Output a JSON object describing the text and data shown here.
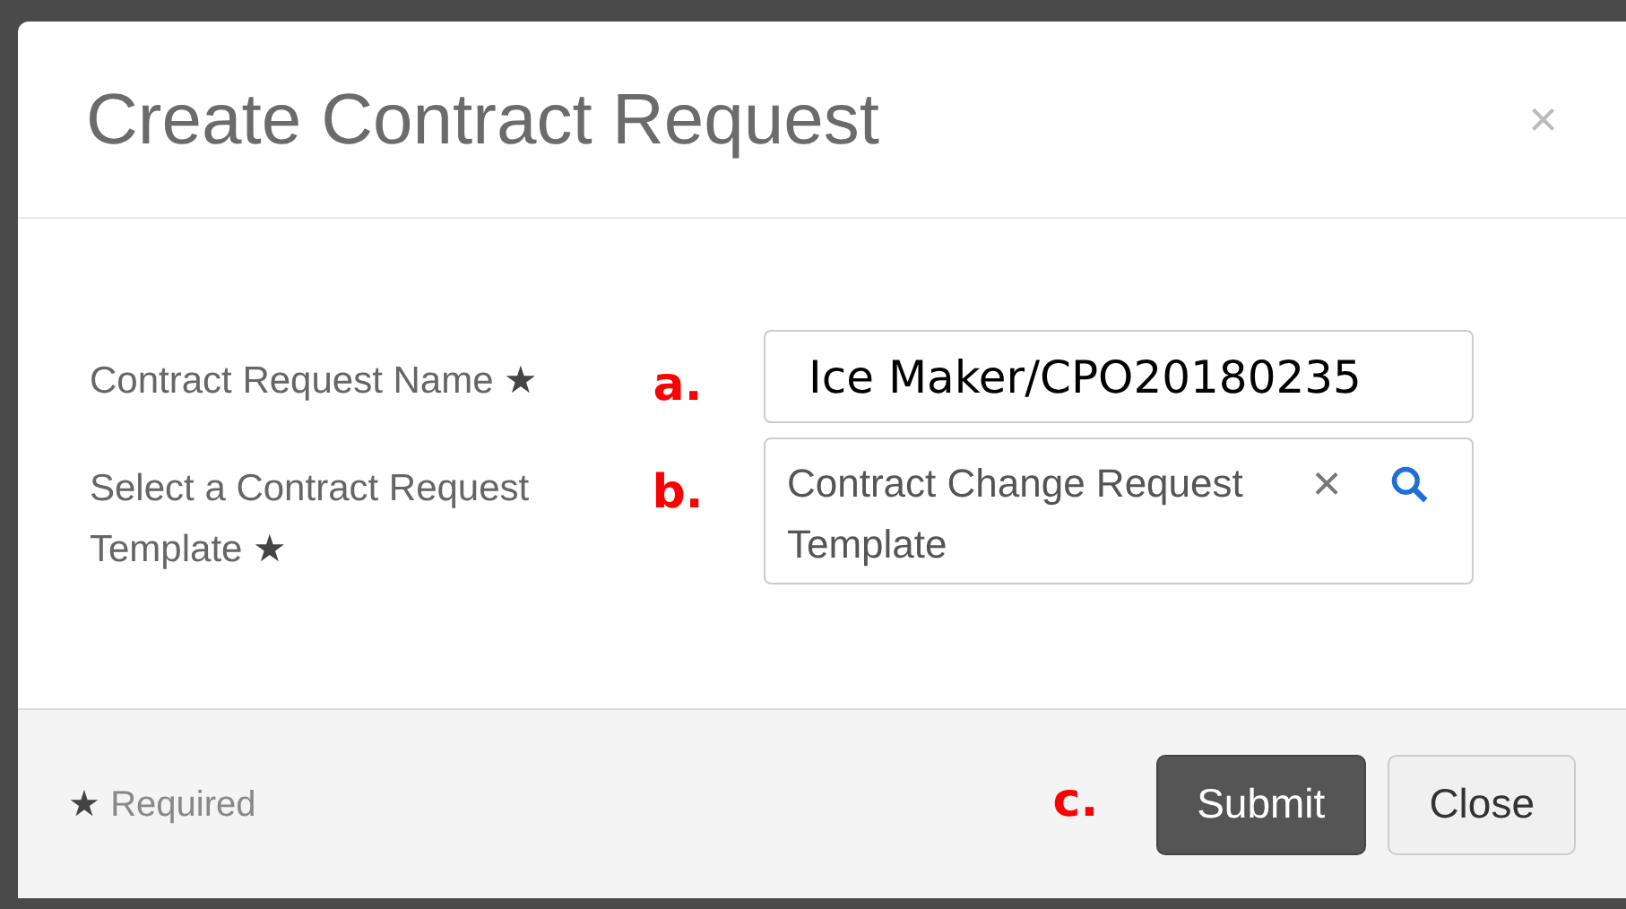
{
  "dialog": {
    "title": "Create Contract Request",
    "close_glyph": "×"
  },
  "fields": [
    {
      "kind": "text",
      "label": "Contract Request Name",
      "required_mark": "★",
      "annotation": "a.",
      "value": "Ice Maker/CPO20180235"
    },
    {
      "kind": "lookup",
      "label": "Select a Contract Request Template",
      "required_mark": "★",
      "annotation": "b.",
      "value": "Contract Change Request Template",
      "clear_glyph": "×"
    }
  ],
  "footer": {
    "required_mark": "★",
    "required_note": "Required",
    "annotation": "c.",
    "buttons": [
      {
        "label": "Submit",
        "kind": "primary"
      },
      {
        "label": "Close",
        "kind": "secondary"
      }
    ]
  }
}
